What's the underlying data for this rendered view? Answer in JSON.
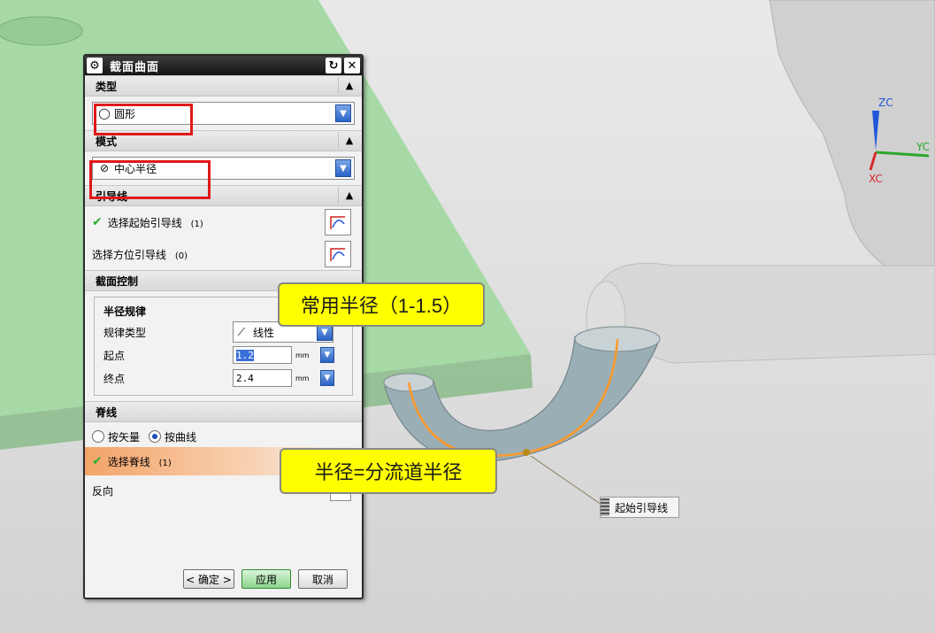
{
  "dialog": {
    "title": "截面曲面",
    "gear_icon": "gear-icon",
    "reset_icon": "reset-icon",
    "close_icon": "close-icon",
    "type_section": {
      "heading": "类型",
      "value": "圆形",
      "icon": "circle-icon"
    },
    "mode_section": {
      "heading": "模式",
      "value": "中心半径",
      "icon": "center-radius-icon"
    },
    "guide_section": {
      "heading": "引导线",
      "start_label": "选择起始引导线",
      "start_count": "(1)",
      "orient_label": "选择方位引导线",
      "orient_count": "(0)"
    },
    "section_control": {
      "heading": "截面控制",
      "group_title": "半径规律",
      "law_type_label": "规律类型",
      "law_type_value": "线性",
      "start_label": "起点",
      "start_value": "1.2",
      "end_label": "终点",
      "end_value": "2.4",
      "unit": "mm"
    },
    "spine_section": {
      "heading": "脊线",
      "radio_vector": "按矢量",
      "radio_curve": "按曲线",
      "selected_radio": "按曲线",
      "select_label": "选择脊线",
      "select_count": "(1)"
    },
    "reverse_label": "反向",
    "buttons": {
      "ok": "< 确定 >",
      "apply": "应用",
      "cancel": "取消"
    }
  },
  "annotations": {
    "callout_radius": "常用半径（1-1.5）",
    "callout_equal": "半径=分流道半径",
    "guide_tag": "起始引导线"
  },
  "axes": {
    "zc": "ZC",
    "yc": "YC",
    "xc": "XC"
  },
  "colors": {
    "plate": "#9fd39f",
    "highlight_orange": "#f3a469",
    "callout_yellow": "#ffff00",
    "red_box": "#e01818"
  }
}
